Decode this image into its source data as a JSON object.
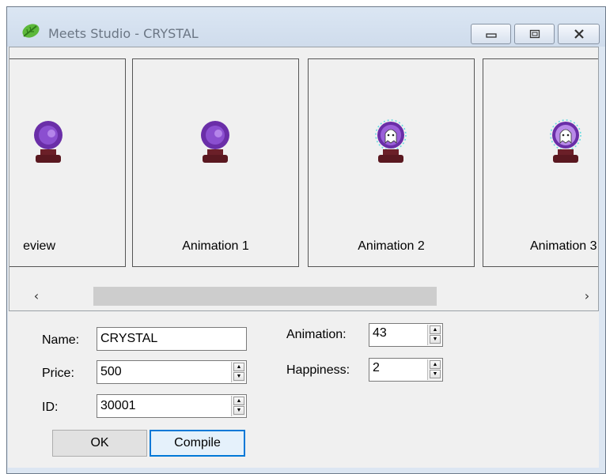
{
  "window": {
    "title": "Meets Studio - CRYSTAL",
    "icons": {
      "app": "leaf-icon",
      "minimize": "minimize-icon",
      "maximize": "maximize-icon",
      "close": "close-icon"
    }
  },
  "gallery": {
    "cards": [
      {
        "label": "eview",
        "sprite": "crystal-ball-purple"
      },
      {
        "label": "Animation 1",
        "sprite": "crystal-ball-purple"
      },
      {
        "label": "Animation 2",
        "sprite": "crystal-ball-ghost"
      },
      {
        "label": "Animation 3",
        "sprite": "crystal-ball-ghost"
      }
    ],
    "scroll": {
      "left_arrow": "‹",
      "right_arrow": "›"
    }
  },
  "form": {
    "name": {
      "label": "Name:",
      "value": "CRYSTAL"
    },
    "price": {
      "label": "Price:",
      "value": "500"
    },
    "id": {
      "label": "ID:",
      "value": "30001"
    },
    "animation": {
      "label": "Animation:",
      "value": "43"
    },
    "happiness": {
      "label": "Happiness:",
      "value": "2"
    }
  },
  "buttons": {
    "ok": "OK",
    "compile": "Compile"
  },
  "colors": {
    "focus": "#0078d7",
    "crystal_purple": "#6a2ea8",
    "crystal_base": "#6b1f28",
    "titlebar": "#dbe6f3"
  }
}
